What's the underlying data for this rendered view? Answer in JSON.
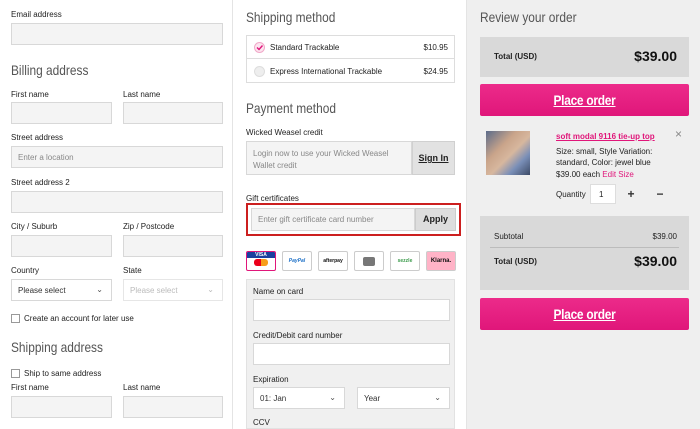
{
  "contact": {
    "email_label": "Email address"
  },
  "billing": {
    "title": "Billing address",
    "first_name_label": "First name",
    "last_name_label": "Last name",
    "street_label": "Street address",
    "street_placeholder": "Enter a location",
    "street2_label": "Street address 2",
    "city_label": "City / Suburb",
    "zip_label": "Zip / Postcode",
    "country_label": "Country",
    "country_value": "Please select",
    "state_label": "State",
    "state_value": "Please select",
    "create_account_label": "Create an account for later use"
  },
  "shipping_address": {
    "title": "Shipping address",
    "same_label": "Ship to same address",
    "first_name_label": "First name",
    "last_name_label": "Last name"
  },
  "shipping_method": {
    "title": "Shipping method",
    "options": [
      {
        "label": "Standard Trackable",
        "price": "$10.95",
        "selected": true
      },
      {
        "label": "Express International Trackable",
        "price": "$24.95",
        "selected": false
      }
    ]
  },
  "payment": {
    "title": "Payment method",
    "credit_label": "Wicked Weasel credit",
    "credit_text": "Login now to use your Wicked Weasel Wallet credit",
    "signin_label": "Sign In",
    "gift_label": "Gift certificates",
    "gift_placeholder": "Enter gift certificate card number",
    "apply_label": "Apply",
    "methods": [
      "VISA",
      "PayPal",
      "afterpay",
      "",
      "sezzle",
      "Klarna."
    ],
    "name_on_card_label": "Name on card",
    "card_number_label": "Credit/Debit card number",
    "expiration_label": "Expiration",
    "exp_month": "01: Jan",
    "exp_year": "Year",
    "ccv_label": "CCV"
  },
  "review": {
    "title": "Review your order",
    "total_label": "Total (USD)",
    "total_value": "$39.00",
    "place_order_label": "Place order",
    "item": {
      "name": "soft modal 9116 tie-up top",
      "size_line": "Size: small, Style Variation:",
      "variation_line": "standard, Color: jewel blue",
      "price_each": "$39.00 each",
      "edit_label": "Edit Size",
      "quantity_label": "Quantity",
      "quantity_value": "1"
    },
    "subtotal_label": "Subtotal",
    "subtotal_value": "$39.00",
    "total2_label": "Total (USD)",
    "total2_value": "$39.00",
    "place_order_label_2": "Place order"
  },
  "colors": {
    "accent": "#e0167a",
    "highlight_border": "#cc1f1f"
  }
}
